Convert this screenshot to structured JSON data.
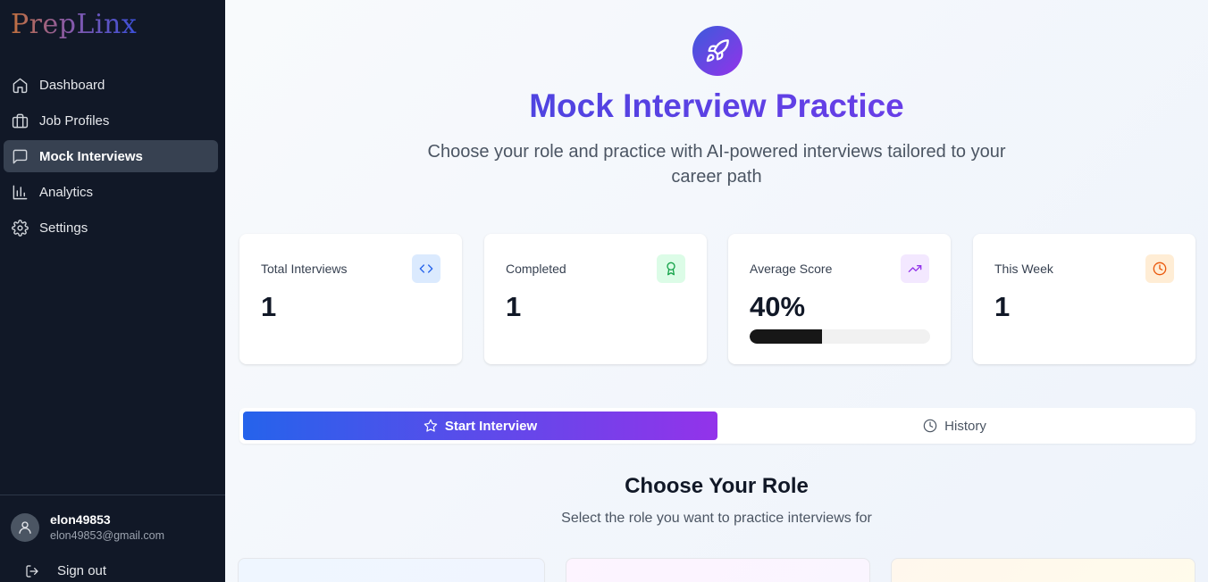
{
  "app": {
    "logo": "PrepLinx"
  },
  "sidebar": {
    "items": [
      {
        "label": "Dashboard",
        "icon": "home-icon"
      },
      {
        "label": "Job Profiles",
        "icon": "briefcase-icon"
      },
      {
        "label": "Mock Interviews",
        "icon": "message-square-icon",
        "active": true
      },
      {
        "label": "Analytics",
        "icon": "bar-chart-icon"
      },
      {
        "label": "Settings",
        "icon": "gear-icon"
      }
    ]
  },
  "user": {
    "name": "elon49853",
    "email": "elon49853@gmail.com",
    "signout_label": "Sign out"
  },
  "header": {
    "icon": "rocket-icon",
    "title": "Mock Interview Practice",
    "subtitle": "Choose your role and practice with AI-powered interviews tailored to your career path"
  },
  "stats": [
    {
      "label": "Total Interviews",
      "value": "1",
      "icon": "code-icon",
      "color": "#2563eb",
      "bg": "#dbeafe"
    },
    {
      "label": "Completed",
      "value": "1",
      "icon": "award-icon",
      "color": "#16a34a",
      "bg": "#dcfce7"
    },
    {
      "label": "Average Score",
      "value": "40%",
      "icon": "trending-up-icon",
      "color": "#9333ea",
      "bg": "#f3e8ff",
      "progress": 0.4
    },
    {
      "label": "This Week",
      "value": "1",
      "icon": "clock-icon",
      "color": "#ea580c",
      "bg": "#ffedd5"
    }
  ],
  "tabs": {
    "start": "Start Interview",
    "history": "History"
  },
  "roles": {
    "title": "Choose Your Role",
    "subtitle": "Select the role you want to practice interviews for"
  },
  "colors": {
    "sidebar_bg": "#111827",
    "accent_start": "#2563eb",
    "accent_end": "#9333ea"
  }
}
